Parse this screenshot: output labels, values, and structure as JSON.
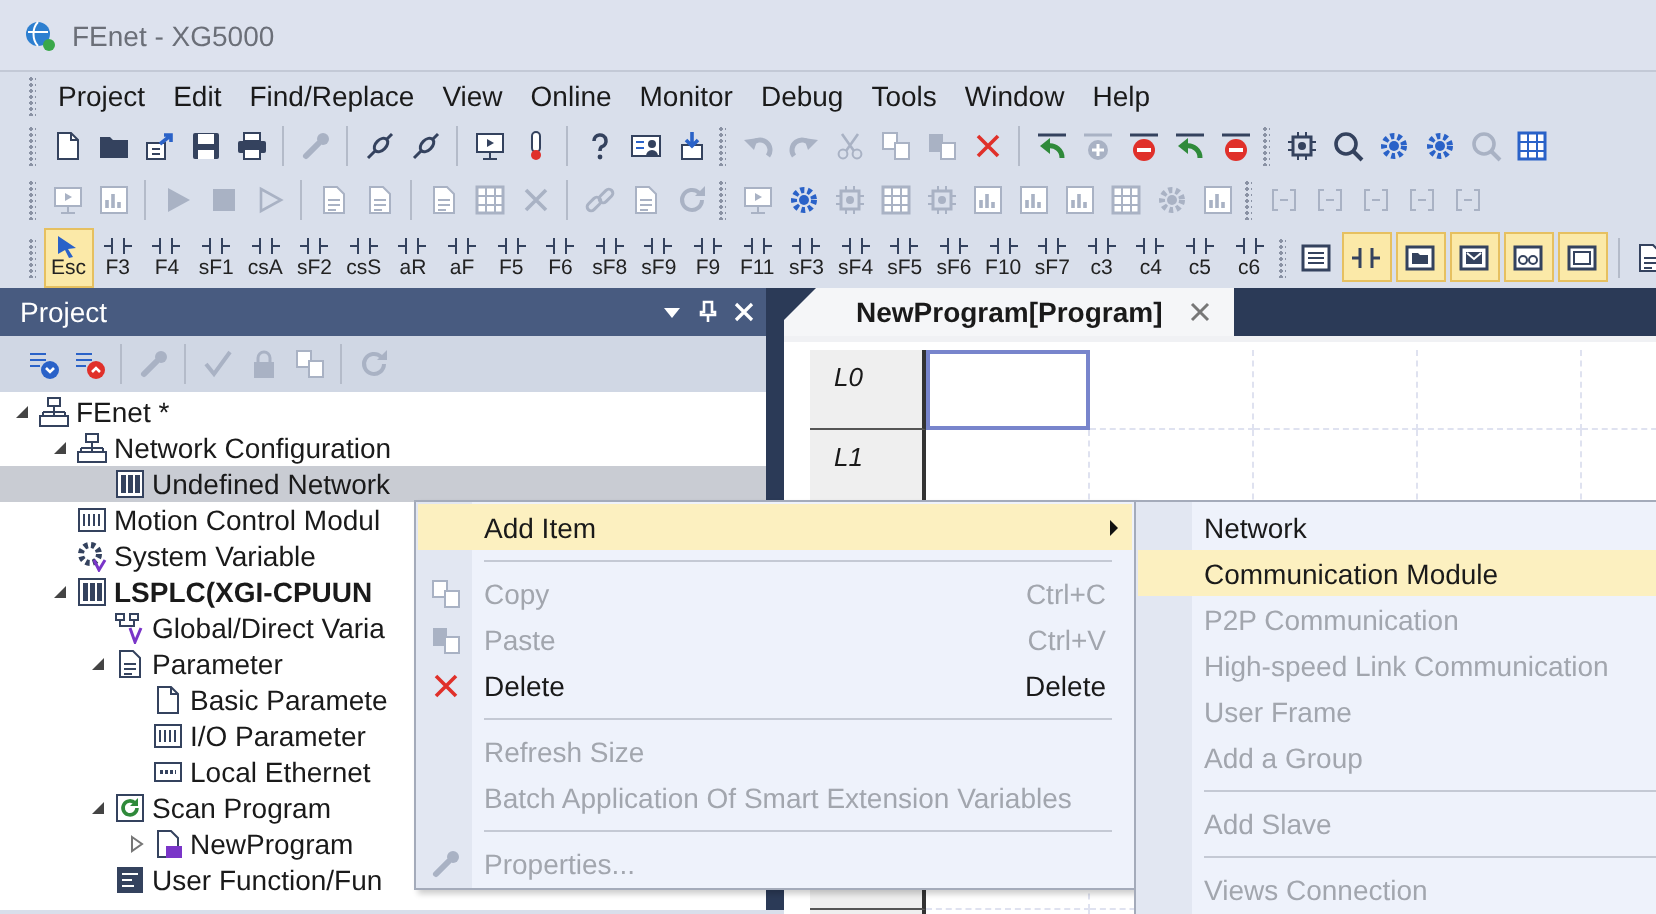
{
  "window": {
    "title": "FEnet - XG5000"
  },
  "menu": [
    "Project",
    "Edit",
    "Find/Replace",
    "View",
    "Online",
    "Monitor",
    "Debug",
    "Tools",
    "Window",
    "Help"
  ],
  "toolbars": {
    "standard": [
      {
        "disabled": false
      },
      {
        "disabled": false
      },
      {
        "disabled": false
      },
      {
        "disabled": false
      },
      {
        "disabled": false
      },
      {
        "disabled": true
      },
      {
        "disabled": false
      },
      {
        "disabled": false
      },
      {
        "disabled": false
      },
      {
        "disabled": false
      },
      {
        "disabled": false
      },
      {
        "disabled": false
      },
      {
        "disabled": false
      },
      {
        "disabled": true
      },
      {
        "disabled": true
      },
      {
        "disabled": true
      },
      {
        "disabled": true
      },
      {
        "disabled": true
      },
      {
        "disabled": false
      },
      {
        "disabled": false
      },
      {
        "disabled": true
      },
      {
        "disabled": false
      },
      {
        "disabled": false
      },
      {
        "disabled": false
      },
      {
        "disabled": false
      },
      {
        "disabled": false
      },
      {
        "disabled": false
      },
      {
        "disabled": false
      },
      {
        "disabled": true
      },
      {
        "disabled": false
      }
    ],
    "online": [
      {
        "disabled": true
      },
      {
        "disabled": true
      },
      {
        "disabled": true
      },
      {
        "disabled": true
      },
      {
        "disabled": true
      },
      {
        "disabled": true
      },
      {
        "disabled": true
      },
      {
        "disabled": true
      },
      {
        "disabled": true
      },
      {
        "disabled": true
      },
      {
        "disabled": true
      },
      {
        "disabled": true
      },
      {
        "disabled": true
      },
      {
        "disabled": true
      },
      {
        "disabled": false
      },
      {
        "disabled": true
      },
      {
        "disabled": true
      },
      {
        "disabled": true
      },
      {
        "disabled": true
      },
      {
        "disabled": true
      },
      {
        "disabled": true
      },
      {
        "disabled": true
      },
      {
        "disabled": true
      },
      {
        "disabled": true
      },
      {
        "disabled": true
      },
      {
        "disabled": true
      },
      {
        "disabled": true
      },
      {
        "disabled": true
      },
      {
        "disabled": true
      }
    ],
    "ladder_keys": [
      {
        "label": "Esc",
        "selected": true
      },
      {
        "label": "F3",
        "selected": false
      },
      {
        "label": "F4",
        "selected": false
      },
      {
        "label": "sF1",
        "selected": false
      },
      {
        "label": "csA",
        "selected": false
      },
      {
        "label": "sF2",
        "selected": false
      },
      {
        "label": "csS",
        "selected": false
      },
      {
        "label": "aR",
        "selected": false
      },
      {
        "label": "aF",
        "selected": false
      },
      {
        "label": "F5",
        "selected": false
      },
      {
        "label": "F6",
        "selected": false
      },
      {
        "label": "sF8",
        "selected": false
      },
      {
        "label": "sF9",
        "selected": false
      },
      {
        "label": "F9",
        "selected": false
      },
      {
        "label": "F11",
        "selected": false
      },
      {
        "label": "sF3",
        "selected": false
      },
      {
        "label": "sF4",
        "selected": false
      },
      {
        "label": "sF5",
        "selected": false
      },
      {
        "label": "sF6",
        "selected": false
      },
      {
        "label": "F10",
        "selected": false
      },
      {
        "label": "sF7",
        "selected": false
      },
      {
        "label": "c3",
        "selected": false
      },
      {
        "label": "c4",
        "selected": false
      },
      {
        "label": "c5",
        "selected": false
      },
      {
        "label": "c6",
        "selected": false
      }
    ],
    "view_modes": [
      {
        "on": true
      },
      {
        "on": true
      },
      {
        "on": true
      },
      {
        "on": true
      },
      {
        "on": true
      }
    ]
  },
  "project_panel": {
    "title": "Project",
    "toolbar": [
      {
        "disabled": false
      },
      {
        "disabled": false
      },
      {
        "disabled": true
      },
      {
        "disabled": true
      },
      {
        "disabled": true
      },
      {
        "disabled": true
      },
      {
        "disabled": true
      }
    ],
    "tree": [
      {
        "label": "FEnet *",
        "kind": "network",
        "expanded": true,
        "selected": false,
        "active": false,
        "children": [
          {
            "label": "Network Configuration",
            "kind": "network",
            "expanded": true,
            "selected": false,
            "active": false,
            "children": [
              {
                "label": "Undefined Network",
                "kind": "rack",
                "selected": true,
                "active": false
              }
            ]
          },
          {
            "label": "Motion Control Modul",
            "kind": "module",
            "selected": false,
            "active": false
          },
          {
            "label": "System Variable",
            "kind": "variable",
            "selected": false,
            "active": false
          },
          {
            "label": "LSPLC(XGI-CPUUN",
            "kind": "rack",
            "expanded": true,
            "selected": false,
            "active": true,
            "children": [
              {
                "label": "Global/Direct Varia",
                "kind": "global",
                "selected": false,
                "active": false
              },
              {
                "label": "Parameter",
                "kind": "parameter",
                "expanded": true,
                "selected": false,
                "active": false,
                "children": [
                  {
                    "label": "Basic Paramete",
                    "kind": "page",
                    "selected": false,
                    "active": false
                  },
                  {
                    "label": "I/O Parameter",
                    "kind": "module",
                    "selected": false,
                    "active": false
                  },
                  {
                    "label": "Local Ethernet",
                    "kind": "port",
                    "selected": false,
                    "active": false
                  }
                ]
              },
              {
                "label": "Scan Program",
                "kind": "scan",
                "expanded": true,
                "selected": false,
                "active": false,
                "children": [
                  {
                    "label": "NewProgram",
                    "kind": "program",
                    "expanded": false,
                    "selected": false,
                    "active": false
                  }
                ]
              },
              {
                "label": "User Function/Fun",
                "kind": "function",
                "selected": false,
                "active": false
              }
            ]
          }
        ]
      }
    ]
  },
  "editor": {
    "tabs": [
      {
        "label": "NewProgram[Program]",
        "selected": true
      }
    ],
    "rows": [
      {
        "label": "L0",
        "cursor": true
      },
      {
        "label": "L1",
        "cursor": false
      }
    ]
  },
  "context_menu": {
    "items": [
      {
        "kind": "item",
        "label": "Add Item",
        "selected": true,
        "disabled": false,
        "submenu": true
      },
      {
        "kind": "separator"
      },
      {
        "kind": "item",
        "label": "Copy",
        "shortcut": "Ctrl+C",
        "selected": false,
        "disabled": true,
        "submenu": false
      },
      {
        "kind": "item",
        "label": "Paste",
        "shortcut": "Ctrl+V",
        "selected": false,
        "disabled": true,
        "submenu": false
      },
      {
        "kind": "item",
        "label": "Delete",
        "shortcut": "Delete",
        "selected": false,
        "disabled": false,
        "submenu": false
      },
      {
        "kind": "separator"
      },
      {
        "kind": "item",
        "label": "Refresh Size",
        "selected": false,
        "disabled": true,
        "submenu": false
      },
      {
        "kind": "item",
        "label": "Batch Application Of Smart Extension Variables",
        "selected": false,
        "disabled": true,
        "submenu": false
      },
      {
        "kind": "separator"
      },
      {
        "kind": "item",
        "label": "Properties...",
        "selected": false,
        "disabled": true,
        "submenu": false
      }
    ]
  },
  "submenu": {
    "items": [
      {
        "kind": "item",
        "label": "Network",
        "selected": false,
        "disabled": false
      },
      {
        "kind": "item",
        "label": "Communication Module",
        "selected": true,
        "disabled": false
      },
      {
        "kind": "item",
        "label": "P2P Communication",
        "selected": false,
        "disabled": true
      },
      {
        "kind": "item",
        "label": "High-speed Link Communication",
        "selected": false,
        "disabled": true
      },
      {
        "kind": "item",
        "label": "User Frame",
        "selected": false,
        "disabled": true
      },
      {
        "kind": "item",
        "label": "Add a Group",
        "selected": false,
        "disabled": true
      },
      {
        "kind": "separator"
      },
      {
        "kind": "item",
        "label": "Add Slave",
        "selected": false,
        "disabled": true
      },
      {
        "kind": "separator"
      },
      {
        "kind": "item",
        "label": "Views Connection",
        "selected": false,
        "disabled": true
      }
    ]
  }
}
